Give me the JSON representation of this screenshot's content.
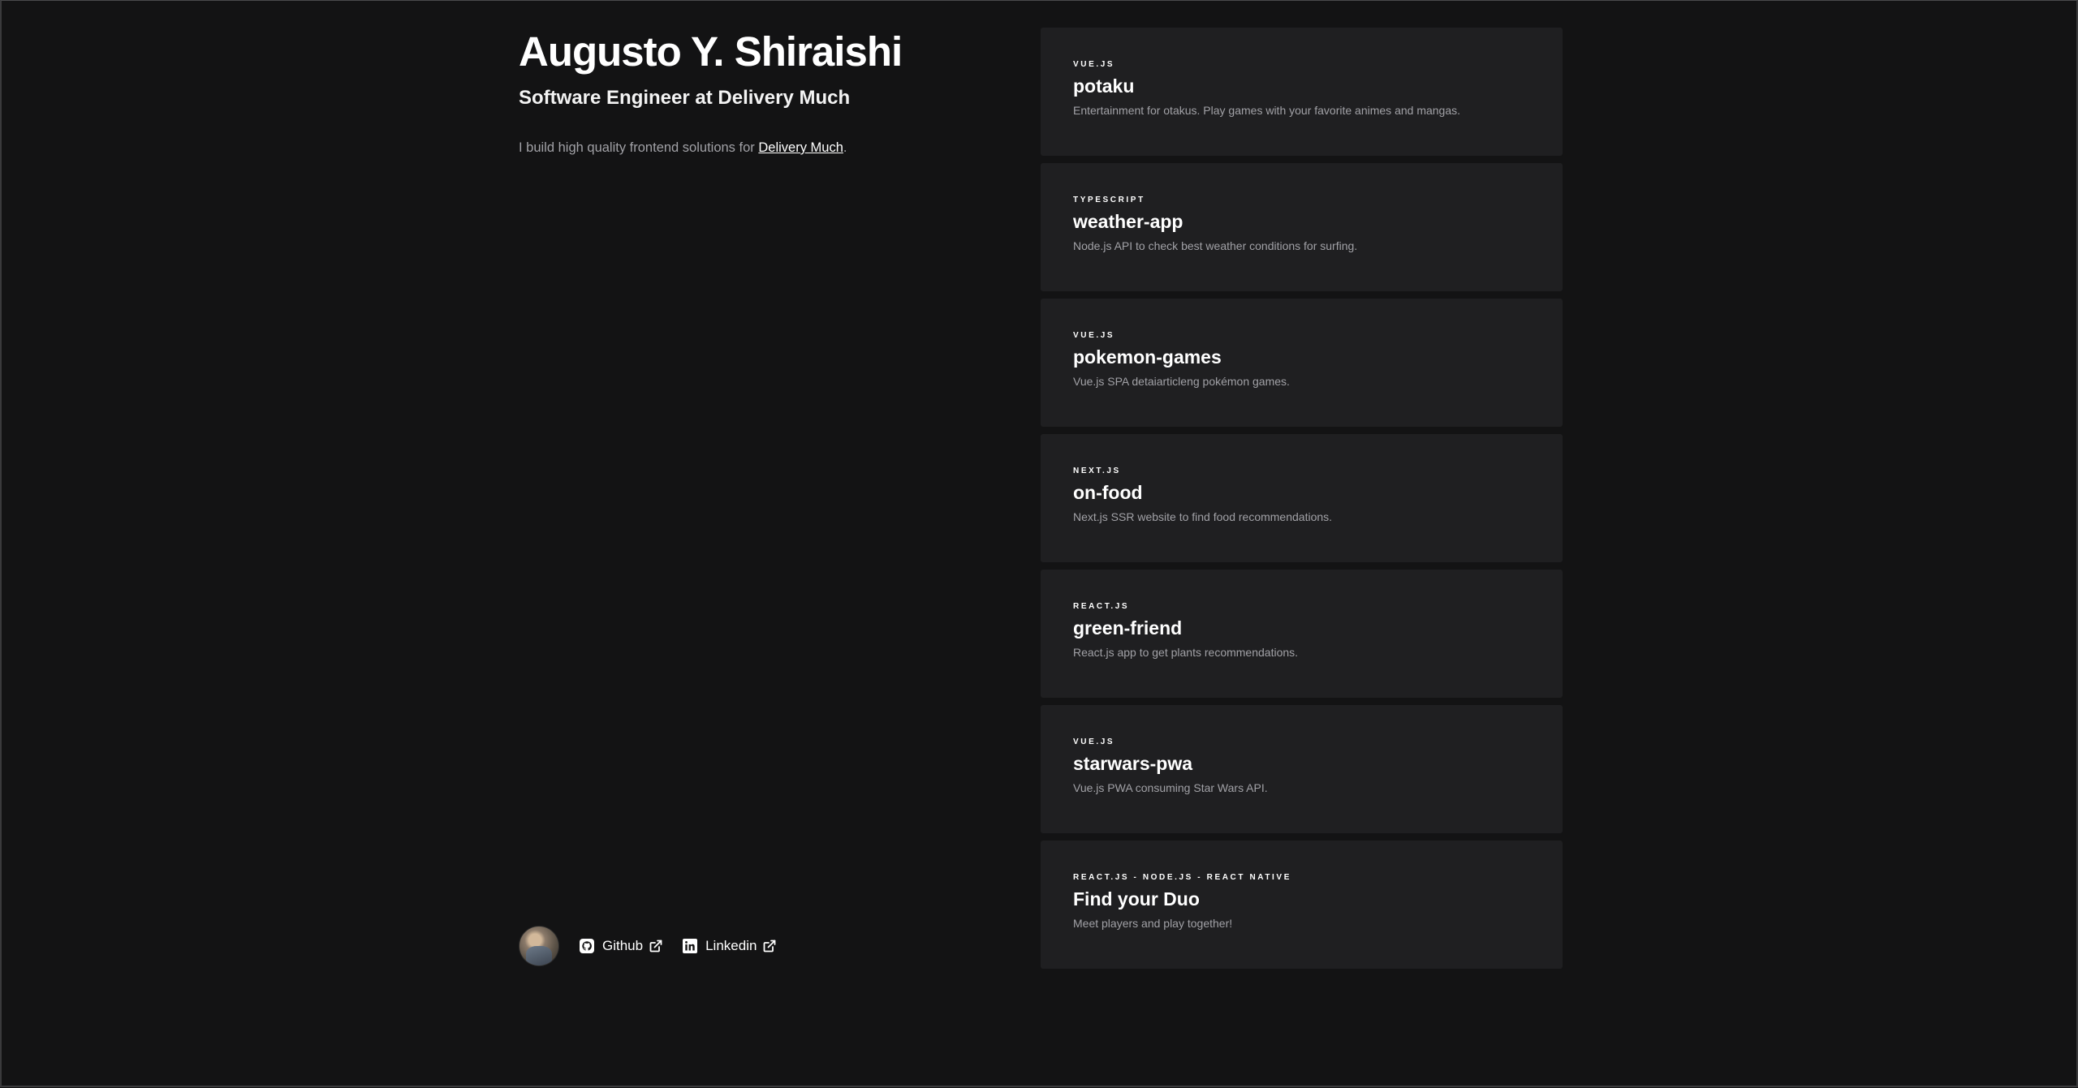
{
  "profile": {
    "name": "Augusto Y. Shiraishi",
    "role": "Software Engineer at Delivery Much",
    "bio_prefix": "I build high quality frontend solutions for ",
    "bio_link": "Delivery Much",
    "bio_suffix": "."
  },
  "social": {
    "github_label": "Github",
    "linkedin_label": "Linkedin"
  },
  "projects": [
    {
      "tech": "VUE.JS",
      "title": "potaku",
      "description": "Entertainment for otakus. Play games with your favorite animes and mangas."
    },
    {
      "tech": "TYPESCRIPT",
      "title": "weather-app",
      "description": "Node.js API to check best weather conditions for surfing."
    },
    {
      "tech": "VUE.JS",
      "title": "pokemon-games",
      "description": "Vue.js SPA detaiarticleng pokémon games."
    },
    {
      "tech": "NEXT.JS",
      "title": "on-food",
      "description": "Next.js SSR website to find food recommendations."
    },
    {
      "tech": "REACT.JS",
      "title": "green-friend",
      "description": "React.js app to get plants recommendations."
    },
    {
      "tech": "VUE.JS",
      "title": "starwars-pwa",
      "description": "Vue.js PWA consuming Star Wars API."
    },
    {
      "tech": "REACT.JS - NODE.JS - REACT NATIVE",
      "title": "Find your Duo",
      "description": "Meet players and play together!"
    }
  ],
  "colors": {
    "background": "#131314",
    "card": "#1f1f21",
    "muted_text": "#a1a1a6",
    "text": "#ffffff"
  },
  "icons": [
    "github-icon",
    "linkedin-icon",
    "external-link-icon"
  ]
}
